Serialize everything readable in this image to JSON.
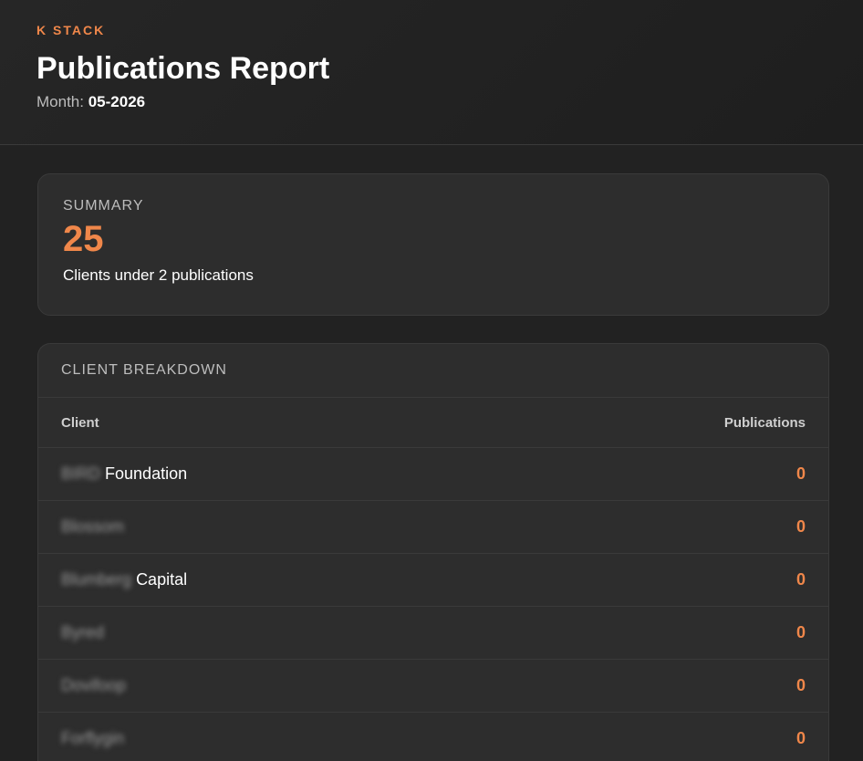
{
  "header": {
    "brand": "K STACK",
    "title": "Publications Report",
    "month_label": "Month:",
    "month_value": "05-2026"
  },
  "summary": {
    "label": "SUMMARY",
    "value": "25",
    "caption": "Clients under 2 publications"
  },
  "breakdown": {
    "title": "CLIENT BREAKDOWN",
    "columns": {
      "client": "Client",
      "publications": "Publications"
    },
    "rows": [
      {
        "client_redacted": "BIRD",
        "client_visible": "Foundation",
        "publications": "0"
      },
      {
        "client_redacted": "Blossom",
        "client_visible": "",
        "publications": "0"
      },
      {
        "client_redacted": "Blumberg",
        "client_visible": "Capital",
        "publications": "0"
      },
      {
        "client_redacted": "Byred",
        "client_visible": "",
        "publications": "0"
      },
      {
        "client_redacted": "Dovifoop",
        "client_visible": "",
        "publications": "0"
      },
      {
        "client_redacted": "Forflygin",
        "client_visible": "",
        "publications": "0"
      }
    ]
  },
  "colors": {
    "accent": "#f0874a",
    "background": "#222222",
    "card": "#2d2d2d",
    "border": "#3a3a3a"
  }
}
